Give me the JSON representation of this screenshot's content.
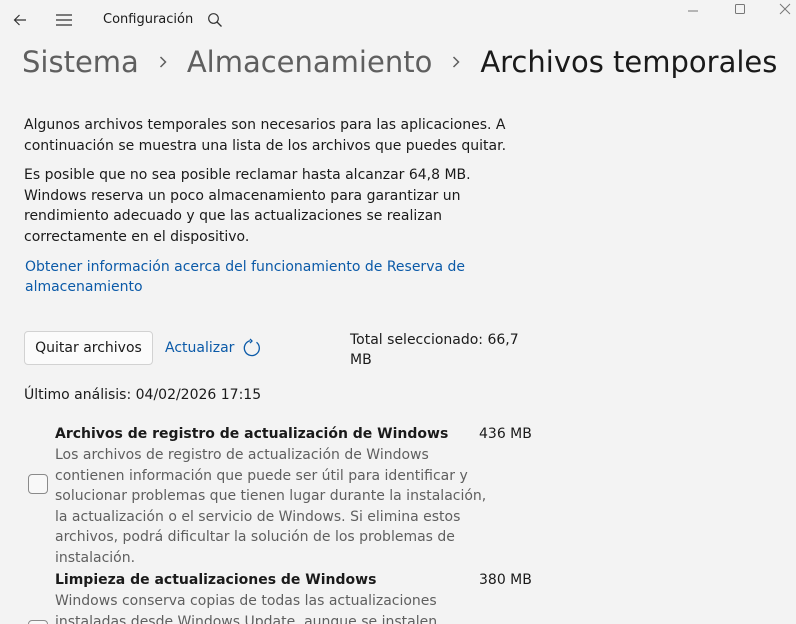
{
  "titlebar": {
    "app_title": "Configuración",
    "back_icon": "arrow-left-icon",
    "menu_icon": "hamburger-icon",
    "search_icon": "search-icon"
  },
  "breadcrumb": {
    "items": [
      "Sistema",
      "Almacenamiento",
      "Archivos temporales"
    ],
    "separator_icon": "chevron-right-icon"
  },
  "intro": {
    "p1": "Algunos archivos temporales son necesarios para las aplicaciones. A continuación se muestra una lista de los archivos que puedes quitar.",
    "p2": "Es posible que no sea posible reclamar hasta alcanzar 64,8 MB. Windows reserva un poco almacenamiento para garantizar un rendimiento adecuado y que las actualizaciones se realizan correctamente en el dispositivo.",
    "link": "Obtener información acerca del funcionamiento de Reserva de almacenamiento"
  },
  "actions": {
    "remove_label": "Quitar archivos",
    "refresh_label": "Actualizar",
    "refresh_icon": "refresh-icon",
    "total_label": "Total seleccionado: 66,7 MB"
  },
  "last_scan": "Último análisis: 04/02/2026 17:15",
  "items": [
    {
      "title": "Archivos de registro de actualización de Windows",
      "size": "436 MB",
      "checked": false,
      "description": "Los archivos de registro de actualización de Windows contienen información que puede ser útil para identificar y solucionar problemas que tienen lugar durante la instalación, la actualización o el servicio de Windows. Si elimina estos archivos, podrá dificultar la solución de los problemas de instalación."
    },
    {
      "title": "Limpieza de actualizaciones de Windows",
      "size": "380 MB",
      "checked": false,
      "description": "Windows conserva copias de todas las actualizaciones instaladas desde Windows Update, aunque se instalen versiones más"
    }
  ],
  "colors": {
    "background": "#f3f3f3",
    "link": "#0b5aa8",
    "muted_text": "#5f5f5f"
  }
}
